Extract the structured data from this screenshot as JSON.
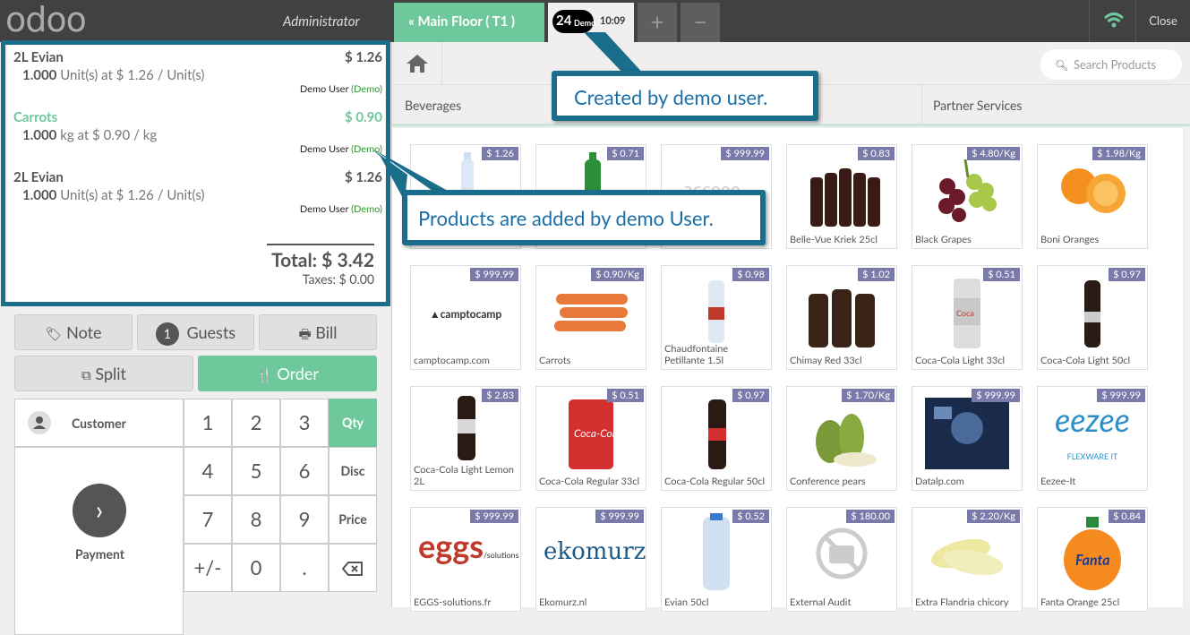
{
  "header": {
    "logo": "odoo",
    "user": "Administrator",
    "floor_button": "Main Floor ( T1 )",
    "order_number": "24",
    "order_user": "Demo",
    "order_time": "10:09",
    "add_label": "+",
    "remove_label": "−",
    "close_label": "Close"
  },
  "ticket": {
    "lines": [
      {
        "name": "2L Evian",
        "price": "$ 1.26",
        "qty_num": "1.000",
        "qty_text": "Unit(s) at $ 1.26 / Unit(s)",
        "user": "Demo User",
        "user_tag": "(Demo)"
      },
      {
        "name": "Carrots",
        "price": "$ 0.90",
        "qty_num": "1.000",
        "qty_text": "kg at $ 0.90 / kg",
        "user": "Demo User",
        "user_tag": "(Demo)"
      },
      {
        "name": "2L Evian",
        "price": "$ 1.26",
        "qty_num": "1.000",
        "qty_text": "Unit(s) at $ 1.26 / Unit(s)",
        "user": "Demo User",
        "user_tag": "(Demo)"
      }
    ],
    "total": "Total: $ 3.42",
    "taxes": "Taxes: $ 0.00"
  },
  "actions": {
    "note": "Note",
    "guests_count": "1",
    "guests": "Guests",
    "bill": "Bill",
    "split": "Split",
    "order": "Order"
  },
  "numpad": {
    "customer": "Customer",
    "payment": "Payment",
    "keys": [
      "1",
      "2",
      "3",
      "4",
      "5",
      "6",
      "7",
      "8",
      "9",
      "+/-",
      "0",
      "."
    ],
    "qty": "Qty",
    "disc": "Disc",
    "price": "Price"
  },
  "products_screen": {
    "search_placeholder": "Search Products",
    "categories": [
      "Beverages",
      "Partner Services"
    ]
  },
  "products": [
    {
      "name": "",
      "price": "$ 1.26"
    },
    {
      "name": "",
      "price": "$ 0.71"
    },
    {
      "name": "",
      "price": "$ 999.99"
    },
    {
      "name": "Belle-Vue Kriek 25cl",
      "price": "$ 0.83"
    },
    {
      "name": "Black Grapes",
      "price": "$ 4.80/Kg"
    },
    {
      "name": "Boni Oranges",
      "price": "$ 1.98/Kg"
    },
    {
      "name": "camptocamp.com",
      "price": "$ 999.99"
    },
    {
      "name": "Carrots",
      "price": "$ 0.90/Kg"
    },
    {
      "name": "Chaudfontaine Petillante 1.5l",
      "price": "$ 0.98"
    },
    {
      "name": "Chimay Red 33cl",
      "price": "$ 1.02"
    },
    {
      "name": "Coca-Cola Light 33cl",
      "price": "$ 0.51"
    },
    {
      "name": "Coca-Cola Light 50cl",
      "price": "$ 0.97"
    },
    {
      "name": "Coca-Cola Light Lemon 2L",
      "price": "$ 2.83"
    },
    {
      "name": "Coca-Cola Regular 33cl",
      "price": "$ 0.51"
    },
    {
      "name": "Coca-Cola Regular 50cl",
      "price": "$ 0.97"
    },
    {
      "name": "Conference pears",
      "price": "$ 1.70/Kg"
    },
    {
      "name": "Datalp.com",
      "price": "$ 999.99"
    },
    {
      "name": "Eezee-It",
      "price": "$ 999.99"
    },
    {
      "name": "EGGS-solutions.fr",
      "price": "$ 999.99"
    },
    {
      "name": "Ekomurz.nl",
      "price": "$ 999.99"
    },
    {
      "name": "Evian 50cl",
      "price": "$ 0.52"
    },
    {
      "name": "External Audit",
      "price": "$ 180.00"
    },
    {
      "name": "Extra Flandria chicory",
      "price": "$ 2.20/Kg"
    },
    {
      "name": "Fanta Orange 25cl",
      "price": "$ 0.84"
    }
  ],
  "product_logos": {
    "camptocamp": "camptocamp",
    "eggs": "eggs",
    "eggs_sub": "/solutions",
    "ekomurz": "ekomurz",
    "eezee": "eezee",
    "eezee_sub": "FLEXWARE IT"
  },
  "callouts": {
    "top": "Created by demo user.",
    "middle": "Products are added by demo User."
  },
  "colors": {
    "accent_green": "#6ec89b",
    "callout_border": "#1a6e8c",
    "topbar": "#414141",
    "price_tag": "#7a7aaa"
  }
}
